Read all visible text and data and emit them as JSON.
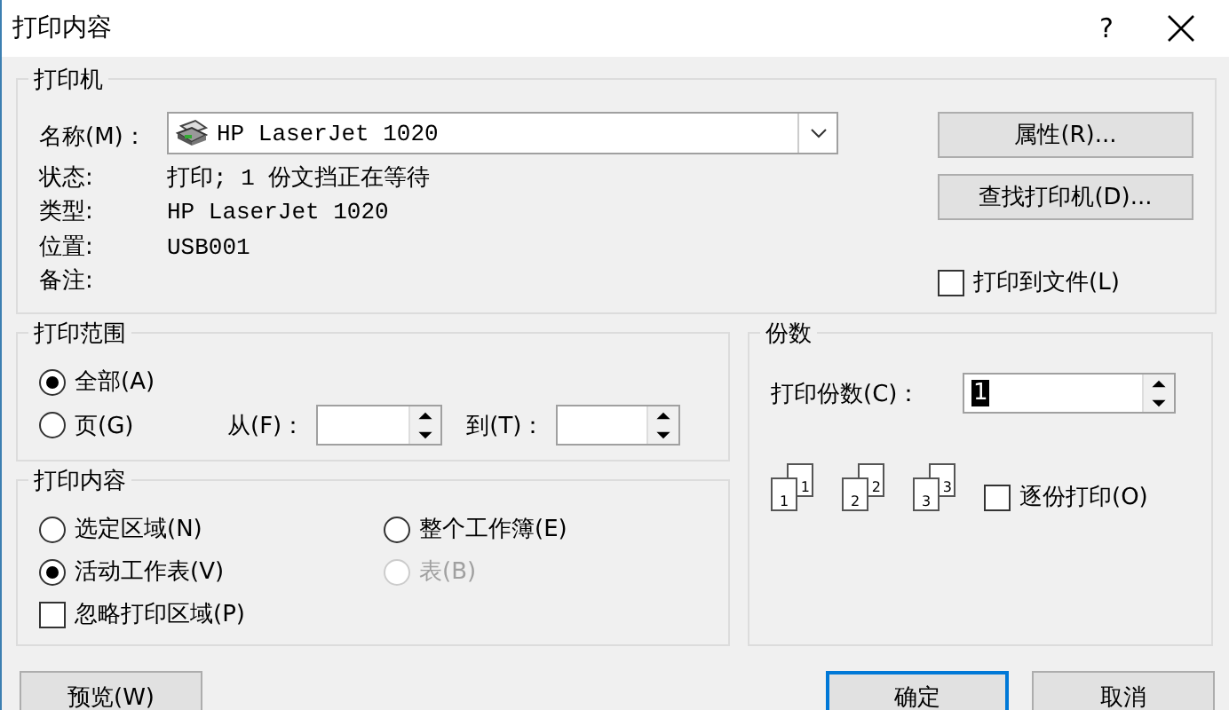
{
  "window": {
    "title": "打印内容",
    "help": "?"
  },
  "printer": {
    "legend": "打印机",
    "name_label": "名称(M)：",
    "name": "HP LaserJet 1020",
    "info": [
      {
        "label": "状态:",
        "value": "打印; 1 份文挡正在等待"
      },
      {
        "label": "类型:",
        "value": "HP LaserJet 1020"
      },
      {
        "label": "位置:",
        "value": "USB001"
      },
      {
        "label": "备注:"
      }
    ],
    "buttons": [
      "属性(R)...",
      "查找打印机(D)..."
    ],
    "print_to_file": {
      "label": "打印到文件(L)",
      "checked": false
    }
  },
  "range": {
    "legend": "打印范围",
    "options": [
      {
        "label": "全部(A)",
        "selected": true
      },
      {
        "label": "页(G)",
        "selected": false
      }
    ],
    "from_label": "从(F)：",
    "to_label": "到(T)："
  },
  "content": {
    "legend": "打印内容",
    "options": [
      {
        "label": "选定区域(N)",
        "selected": false,
        "disabled": false
      },
      {
        "label": "整个工作簿(E)",
        "selected": false,
        "disabled": false
      },
      {
        "label": "活动工作表(V)",
        "selected": true,
        "disabled": false
      },
      {
        "label": "表(B)",
        "selected": false,
        "disabled": true
      }
    ],
    "ignore_area": {
      "label": "忽略打印区域(P)",
      "checked": false
    }
  },
  "copies": {
    "legend": "份数",
    "count_label": "打印份数(C)：",
    "count": "1",
    "collate_pages": [
      {
        "back": "1",
        "front": "1"
      },
      {
        "back": "2",
        "front": "2"
      },
      {
        "back": "3",
        "front": "3"
      }
    ],
    "collate": {
      "label": "逐份打印(O)",
      "checked": false
    }
  },
  "footer_buttons": [
    {
      "label": "预览(W)",
      "kind": "normal"
    },
    {
      "label": "确定",
      "kind": "default"
    },
    {
      "label": "取消",
      "kind": "normal"
    }
  ]
}
